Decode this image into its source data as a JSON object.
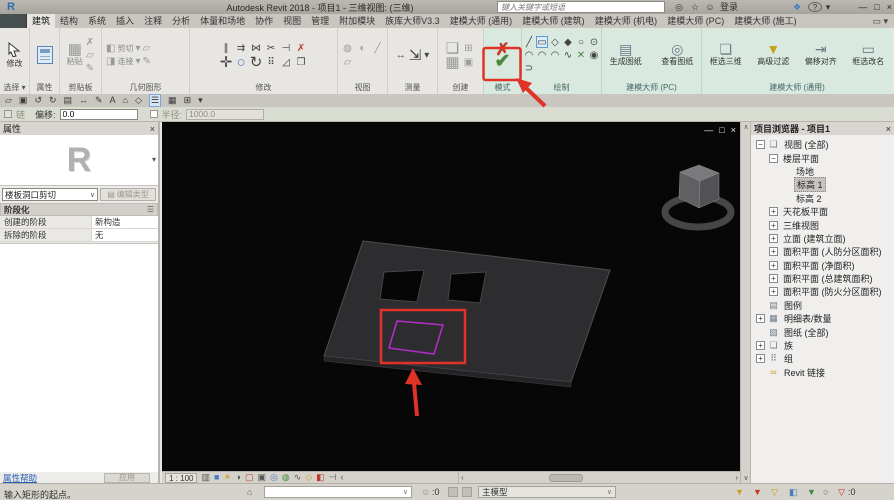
{
  "title_bar": {
    "title": "Autodesk Revit 2018 -   项目1 - 三维视图: (三维)",
    "search_placeholder": "键入关键字或短语",
    "sign_in_label": "登录"
  },
  "tabs": [
    {
      "label": "建筑",
      "active": true
    },
    {
      "label": "结构"
    },
    {
      "label": "系统"
    },
    {
      "label": "插入"
    },
    {
      "label": "注释"
    },
    {
      "label": "分析"
    },
    {
      "label": "体量和场地"
    },
    {
      "label": "协作"
    },
    {
      "label": "视图"
    },
    {
      "label": "管理"
    },
    {
      "label": "附加模块"
    },
    {
      "label": "族库大师V3.3"
    },
    {
      "label": "建模大师 (通用)"
    },
    {
      "label": "建模大师 (建筑)"
    },
    {
      "label": "建模大师 (机电)"
    },
    {
      "label": "建模大师 (PC)"
    },
    {
      "label": "建模大师 (施工)"
    }
  ],
  "ribbon": {
    "modify_label": "修改",
    "panel_select": "选择 ▾",
    "panel_properties": "属性",
    "paste_label": "粘贴",
    "panel_clipboard": "剪贴板",
    "cut_label": "剪切",
    "join_label": "连接",
    "panel_geometry": "几何图形",
    "panel_modify": "修改",
    "panel_view": "视图",
    "panel_measure": "测量",
    "panel_create": "创建",
    "panel_mode": "模式",
    "panel_draw": "绘制",
    "btn_generate_sheet": "生成图纸",
    "btn_view_sheet": "查看图纸",
    "panel_mc_pc": "建模大师 (PC)",
    "btn_box_select_3d": "框选三维",
    "btn_adv_filter": "高级过滤",
    "btn_offset_align": "偏移对齐",
    "btn_box_rename": "框选改名",
    "panel_mc_general": "建模大师 (通用)"
  },
  "options_bar": {
    "chain_label": "链",
    "offset_label": "偏移:",
    "offset_value": "0.0",
    "radius_label": "半径:",
    "radius_value": "1000.0"
  },
  "properties": {
    "header": "属性",
    "preview_label": "R",
    "type_selector": "楼板洞口剪切",
    "edit_type_label": "编辑类型",
    "section_phasing": "阶段化",
    "rows": [
      {
        "label": "创建的阶段",
        "value": "新构造"
      },
      {
        "label": "拆除的阶段",
        "value": "无"
      }
    ],
    "help_label": "属性帮助",
    "apply_label": "应用"
  },
  "viewport": {
    "scale": "1 : 100"
  },
  "browser": {
    "header": "项目浏览器 - 项目1",
    "tree": [
      {
        "label": "视图 (全部)",
        "exp": "−"
      },
      {
        "label": "楼层平面",
        "exp": "−"
      },
      {
        "label": "场地",
        "exp": ""
      },
      {
        "label": "标高 1",
        "exp": "",
        "selected": true
      },
      {
        "label": "标高 2",
        "exp": ""
      },
      {
        "label": "天花板平面",
        "exp": "+"
      },
      {
        "label": "三维视图",
        "exp": "+"
      },
      {
        "label": "立面 (建筑立面)",
        "exp": "+"
      },
      {
        "label": "面积平面 (人防分区面积)",
        "exp": "+"
      },
      {
        "label": "面积平面 (净面积)",
        "exp": "+"
      },
      {
        "label": "面积平面 (总建筑面积)",
        "exp": "+"
      },
      {
        "label": "面积平面 (防火分区面积)",
        "exp": "+"
      },
      {
        "label": "图例",
        "exp": ""
      },
      {
        "label": "明细表/数量",
        "exp": "+"
      },
      {
        "label": "图纸 (全部)",
        "exp": ""
      },
      {
        "label": "族",
        "exp": "+"
      },
      {
        "label": "组",
        "exp": "+"
      },
      {
        "label": "Revit 链接",
        "exp": ""
      }
    ]
  },
  "status_bar": {
    "hint": "输入矩形的起点。",
    "main_model": "主模型",
    "editable_count": ":0",
    "filter_count": ":0"
  },
  "colors": {
    "annotation_red": "#e03226",
    "check_green": "#55a044",
    "sketch_purple": "#b12cc4",
    "contextual_mint": "#d9e9df"
  },
  "icons": {
    "revit-logo": "R",
    "search-go": "◎",
    "favorites-star": "☆",
    "sign-in-user": "☺",
    "comm-center": "❖",
    "help": "?",
    "menu-down": "▾",
    "win-min": "—",
    "win-restore": "□",
    "win-close": "×",
    "tab-overflow": "▭ ▾",
    "paste": "▦",
    "cut-x": "✗",
    "copy": "▱",
    "brush": "✎",
    "cut-geo": "◧",
    "join-geo": "◨",
    "dd": "▾",
    "move": "✛",
    "rotate": "↻",
    "mirror": "⋈",
    "array": "⠿",
    "align": "∥",
    "offset": "⇉",
    "trim": "⊣",
    "split": "✂",
    "delete": "✗",
    "pin": "○",
    "scale": "◿",
    "join-el": "❐",
    "lightbulb": "◍",
    "halfview": "◐",
    "thinlines": "╱",
    "ruler": "↔",
    "angle": "∠",
    "measure-diag": "⇲",
    "create-group": "❏",
    "create-parts": "▣",
    "create-assembly": "▦",
    "create-similar": "⊞",
    "quit-x": "✗",
    "finish-check": "✔",
    "draw-line": "╱",
    "draw-rect": "▭",
    "draw-poly-in": "◇",
    "draw-poly-out": "◆",
    "draw-circle": "○",
    "draw-ellipse": "⊙",
    "draw-arc1": "◠",
    "draw-arc2": "◠",
    "draw-arc3": "◠",
    "draw-spline": "∿",
    "draw-x": "⨯",
    "draw-pick": "◉",
    "draw-pickwall": "⊃",
    "draw-axis": "✕",
    "gen-sheet": "▤",
    "view-sheet": "◎",
    "box3d": "❏",
    "adv-filter": "▼",
    "offset-align": "⇥",
    "box-rename": "▭",
    "qat-open": "▱",
    "qat-save": "▣",
    "qat-undo": "↺",
    "qat-redo": "↻",
    "qat-print": "▤",
    "qat-dim": "↔",
    "qat-sketch": "✎",
    "qat-text": "A",
    "qat-home": "⌂",
    "qat-tag": "◇",
    "qat-list": "☰",
    "qat-win": "▦",
    "qat-switch": "⊞",
    "edit-type": "▤",
    "pin-section": "☰",
    "house": "⌂",
    "dd2": "∨",
    "worksets-user": "☺",
    "funnel-yellow": "▼",
    "funnel-redx": "▼",
    "funnel-frame": "▽",
    "box-blue": "◧",
    "funnel-green": "▼",
    "gear": "○",
    "filter": "▽",
    "scroll-up": "∧",
    "scroll-down": "∨",
    "scroll-left": "‹",
    "scroll-right": "›",
    "tree-views": "❑",
    "tree-legend": "▤",
    "tree-schedule": "▦",
    "tree-sheet": "▧",
    "tree-family": "❏",
    "tree-group": "⠿",
    "tree-link": "∞"
  }
}
